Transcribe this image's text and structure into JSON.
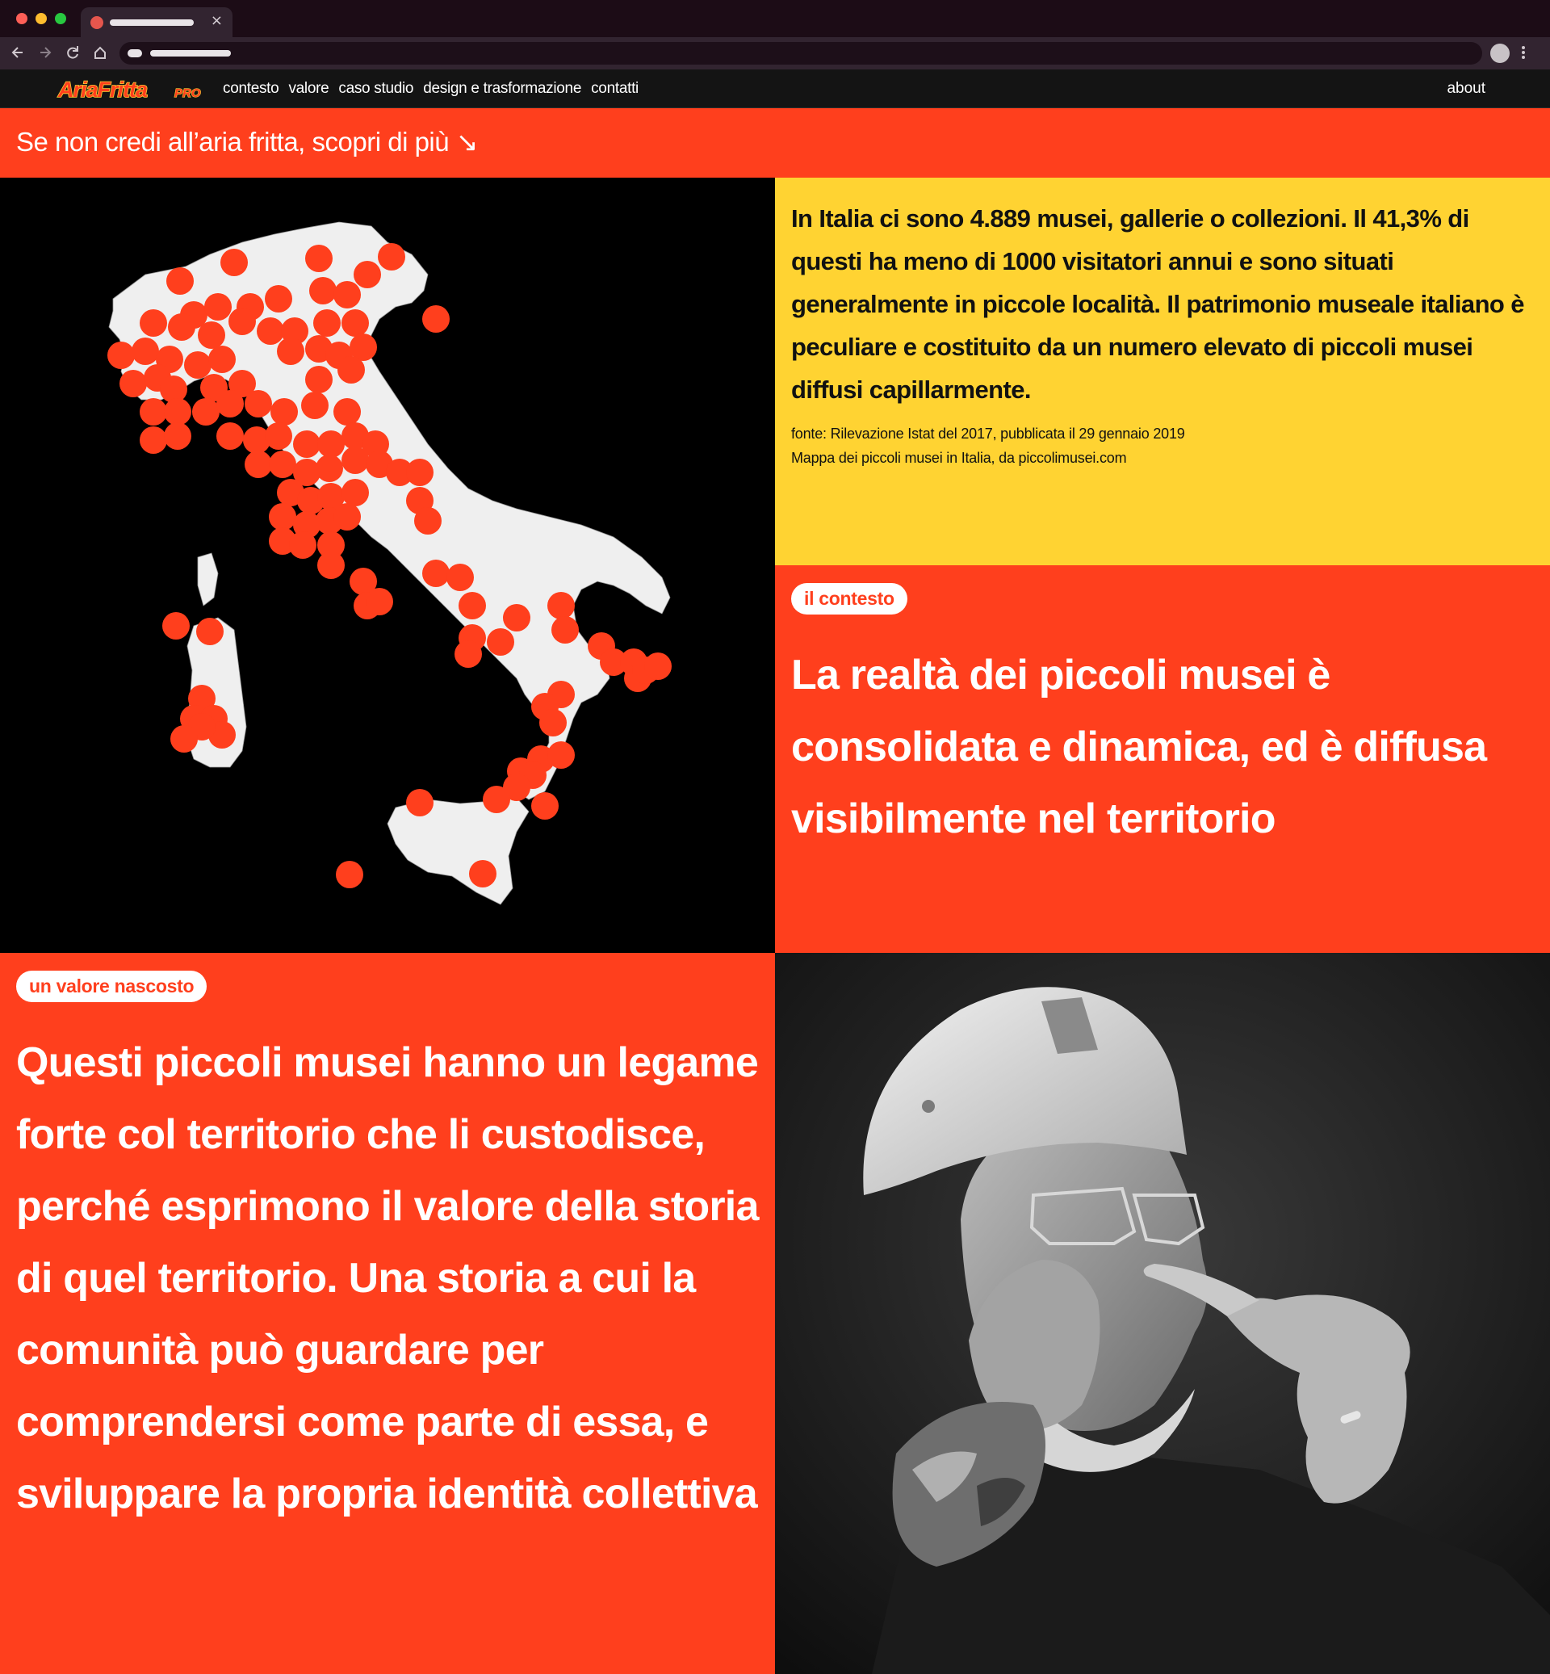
{
  "browser": {
    "tab_close": "×",
    "back_icon": "arrow-left-icon",
    "forward_icon": "arrow-right-icon",
    "reload_icon": "reload-icon",
    "home_icon": "home-icon",
    "menu_icon": "kebab-menu-icon"
  },
  "nav": {
    "logo_main": "AriaFritta",
    "logo_sub": "PRO",
    "links": [
      "contesto",
      "valore",
      "caso studio",
      "design e trasformazione",
      "contatti"
    ],
    "about": "about"
  },
  "banner": {
    "text": "Se non credi all’aria fritta, scopri di più ↘"
  },
  "stats": {
    "text": "In Italia ci sono 4.889 musei, gallerie o collezioni. Il 41,3% di questi ha meno di 1000 visitatori annui e sono situati generalmente in piccole località. Il patrimonio museale italiano è peculiare e costituito da un numero elevato di piccoli musei diffusi capillarmente.",
    "source_1": "fonte: Rilevazione Istat del 2017, pubblicata il 29 gennaio 2019",
    "source_2": "Mappa dei piccoli musei in Italia, da piccolimusei.com"
  },
  "context": {
    "tag": "il contesto",
    "title": "La realtà dei piccoli musei è consolidata e dinamica, ed è diffusa visibilmente nel territorio"
  },
  "value": {
    "tag": "un valore nascosto",
    "text": "Questi piccoli musei hanno un legame forte col territorio che li custodisce, perché esprimono il valore della storia di quel territorio. Una storia a cui la comunità può guardare per comprendersi come parte di essa, e sviluppare la propria identità collettiva"
  },
  "colors": {
    "accent_red": "#ff3f1d",
    "yellow": "#ffd332",
    "map_land": "#efefef",
    "map_dot": "#ff3f1d"
  }
}
